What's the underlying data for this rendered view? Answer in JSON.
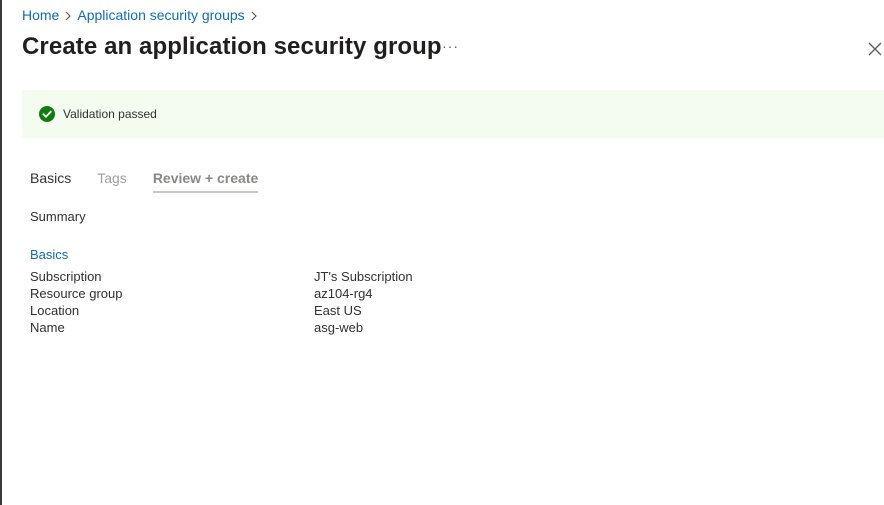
{
  "breadcrumb": [
    {
      "label": "Home"
    },
    {
      "label": "Application security groups"
    }
  ],
  "page": {
    "title": "Create an application security group",
    "more_label": "···",
    "close_icon": "close-icon"
  },
  "banner": {
    "icon": "checkmark-circle-icon",
    "message": "Validation passed",
    "icon_color": "#107c10",
    "background": "#f4fbef"
  },
  "tabs": [
    {
      "label": "Basics",
      "state": "completed"
    },
    {
      "label": "Tags",
      "state": "disabled"
    },
    {
      "label": "Review + create",
      "state": "active"
    }
  ],
  "summary_heading": "Summary",
  "section": {
    "title": "Basics",
    "rows": [
      {
        "key": "Subscription",
        "value": "JT's Subscription"
      },
      {
        "key": "Resource group",
        "value": "az104-rg4"
      },
      {
        "key": "Location",
        "value": "East US"
      },
      {
        "key": "Name",
        "value": "asg-web"
      }
    ]
  },
  "colors": {
    "link": "#0f6cbd",
    "text": "#323130"
  }
}
